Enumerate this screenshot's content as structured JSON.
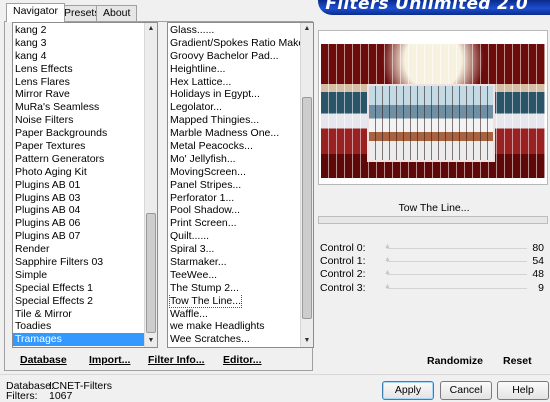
{
  "header": {
    "title": "Filters Unlimited 2.0"
  },
  "tabs": [
    {
      "label": "Navigator",
      "active": true
    },
    {
      "label": "Presets",
      "active": false
    },
    {
      "label": "About",
      "active": false
    }
  ],
  "categories": {
    "items": [
      "kang 2",
      "kang 3",
      "kang 4",
      "Lens Effects",
      "Lens Flares",
      "Mirror Rave",
      "MuRa's Seamless",
      "Noise Filters",
      "Paper Backgrounds",
      "Paper Textures",
      "Pattern Generators",
      "Photo Aging Kit",
      "Plugins AB 01",
      "Plugins AB 03",
      "Plugins AB 04",
      "Plugins AB 06",
      "Plugins AB 07",
      "Render",
      "Sapphire Filters 03",
      "Simple",
      "Special Effects 1",
      "Special Effects 2",
      "Tile & Mirror",
      "Toadies",
      "Tramages"
    ],
    "selected": "Tramages"
  },
  "filters": {
    "items": [
      "Glass......",
      "Gradient/Spokes Ratio Maker...",
      "Groovy Bachelor Pad...",
      "Heightline...",
      "Hex Lattice...",
      "Holidays in Egypt...",
      "Legolator...",
      "Mapped Thingies...",
      "Marble Madness One...",
      "Metal Peacocks...",
      "Mo' Jellyfish...",
      "MovingScreen...",
      "Panel Stripes...",
      "Perforator 1...",
      "Pool Shadow...",
      "Print Screen...",
      "Quilt......",
      "Spiral 3...",
      "Starmaker...",
      "TeeWee...",
      "The Stump 2...",
      "Tow The Line...",
      "Waffle...",
      "we make Headlights",
      "Wee Scratches..."
    ],
    "focused": "Tow The Line..."
  },
  "left_buttons": {
    "database": "Database",
    "import": "Import...",
    "filter_info": "Filter Info...",
    "editor": "Editor..."
  },
  "filter_name": "Tow The Line...",
  "controls": [
    {
      "label": "Control 0:",
      "value": "80"
    },
    {
      "label": "Control 1:",
      "value": "54"
    },
    {
      "label": "Control 2:",
      "value": "48"
    },
    {
      "label": "Control 3:",
      "value": "9"
    }
  ],
  "right_buttons": {
    "randomize": "Randomize",
    "reset": "Reset"
  },
  "info": {
    "database_label": "Database:",
    "database_value": "ICNET-Filters",
    "filters_label": "Filters:",
    "filters_value": "1067"
  },
  "dialog_buttons": {
    "apply": "Apply",
    "cancel": "Cancel",
    "help": "Help"
  },
  "icons": {
    "scroll_up": "scroll-up-icon",
    "scroll_down": "scroll-down-icon"
  }
}
